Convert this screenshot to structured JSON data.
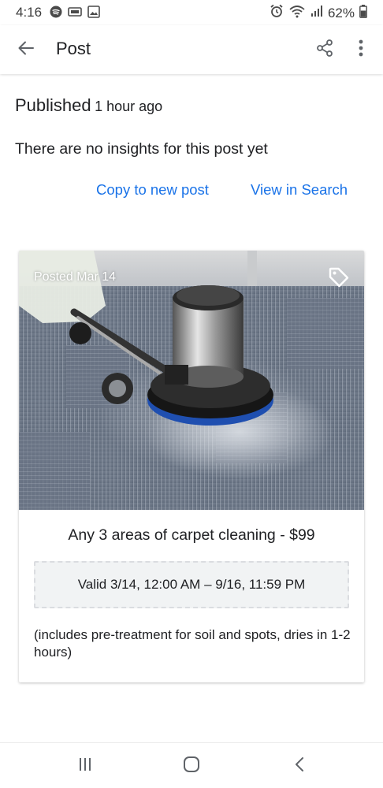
{
  "status_bar": {
    "time": "4:16",
    "battery": "62%"
  },
  "app_bar": {
    "title": "Post"
  },
  "content": {
    "published_label": "Published",
    "published_time": "1 hour ago",
    "insights_message": "There are no insights for this post yet",
    "copy_link": "Copy to new post",
    "view_link": "View in Search"
  },
  "post": {
    "posted_date": "Posted Mar 14",
    "title": "Any 3 areas of carpet cleaning - $99",
    "validity": "Valid 3/14, 12:00 AM – 9/16, 11:59 PM",
    "description": "(includes pre-treatment for soil and spots, dries in 1-2 hours)"
  },
  "colors": {
    "accent": "#1a73e8",
    "text": "#202124",
    "validity_bg": "#f1f3f4"
  },
  "icons": [
    "spotify-icon",
    "cast-icon",
    "gallery-icon",
    "alarm-icon",
    "wifi-icon",
    "signal-icon",
    "battery-icon",
    "back-arrow-icon",
    "share-icon",
    "more-vert-icon",
    "tag-icon",
    "recent-apps-icon",
    "home-icon",
    "nav-back-icon"
  ]
}
